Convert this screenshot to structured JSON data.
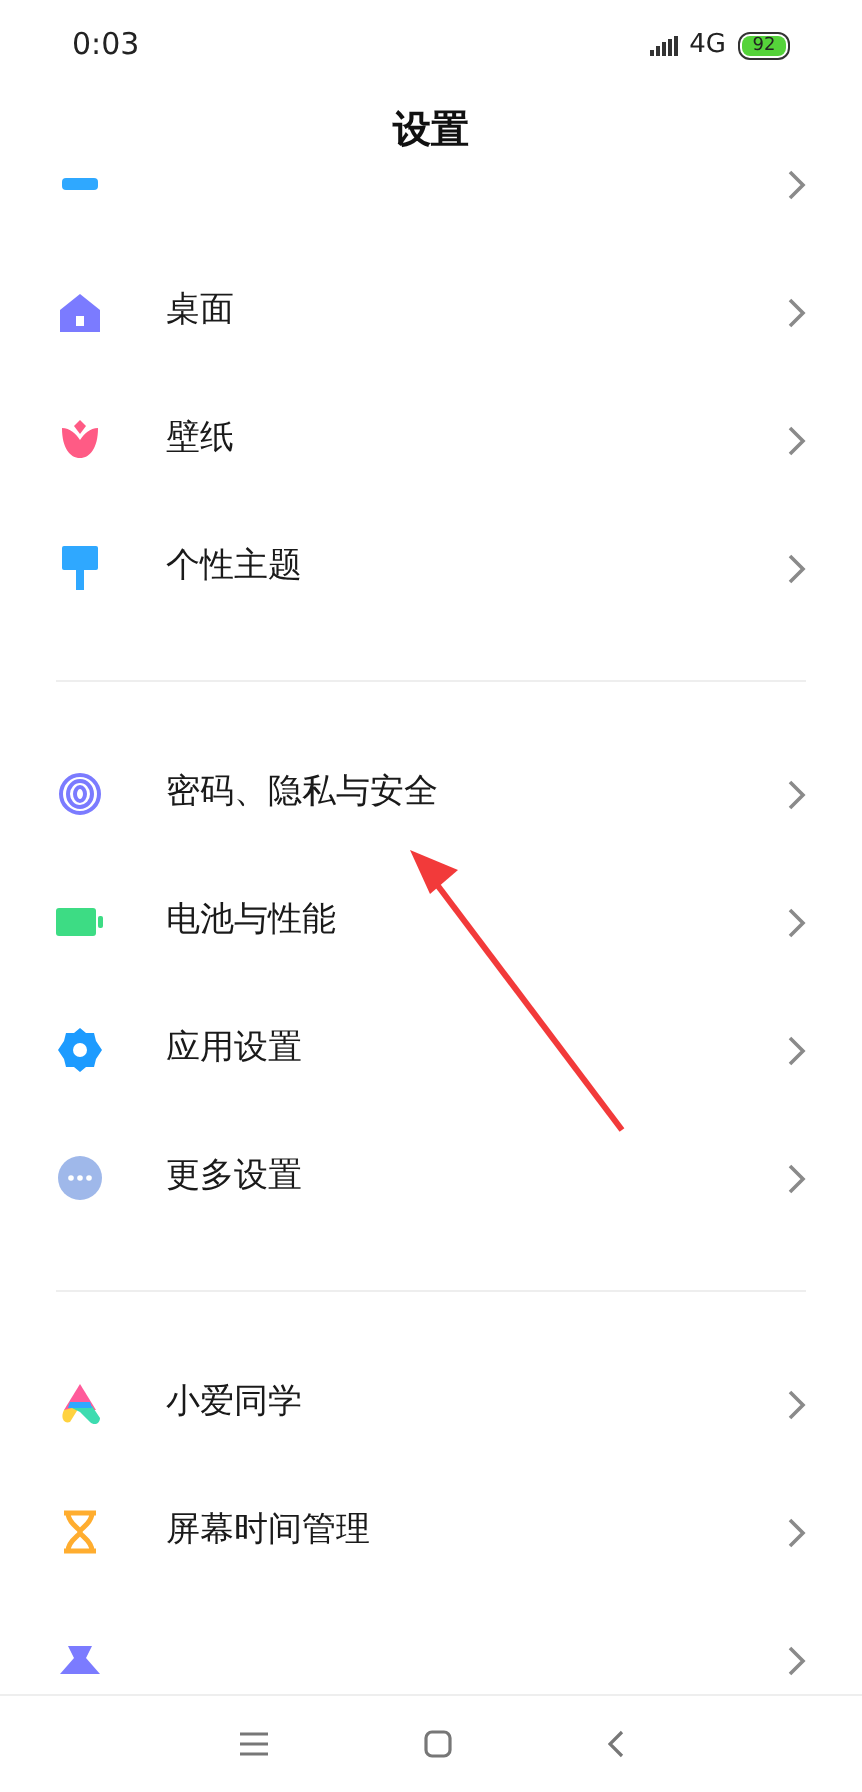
{
  "status_bar": {
    "time": "0:03",
    "network": "4G",
    "battery": "92"
  },
  "title": "设置",
  "groups": [
    {
      "items": [
        {
          "kind": "cut"
        },
        {
          "kind": "row",
          "label": "桌面"
        },
        {
          "kind": "row",
          "label": "壁纸"
        },
        {
          "kind": "row",
          "label": "个性主题"
        }
      ]
    },
    {
      "items": [
        {
          "kind": "row",
          "label": "密码、隐私与安全"
        },
        {
          "kind": "row",
          "label": "电池与性能"
        },
        {
          "kind": "row",
          "label": "应用设置"
        },
        {
          "kind": "row",
          "label": "更多设置"
        }
      ]
    },
    {
      "items": [
        {
          "kind": "row",
          "label": "小爱同学"
        },
        {
          "kind": "row",
          "label": "屏幕时间管理"
        },
        {
          "kind": "cut"
        }
      ]
    }
  ]
}
